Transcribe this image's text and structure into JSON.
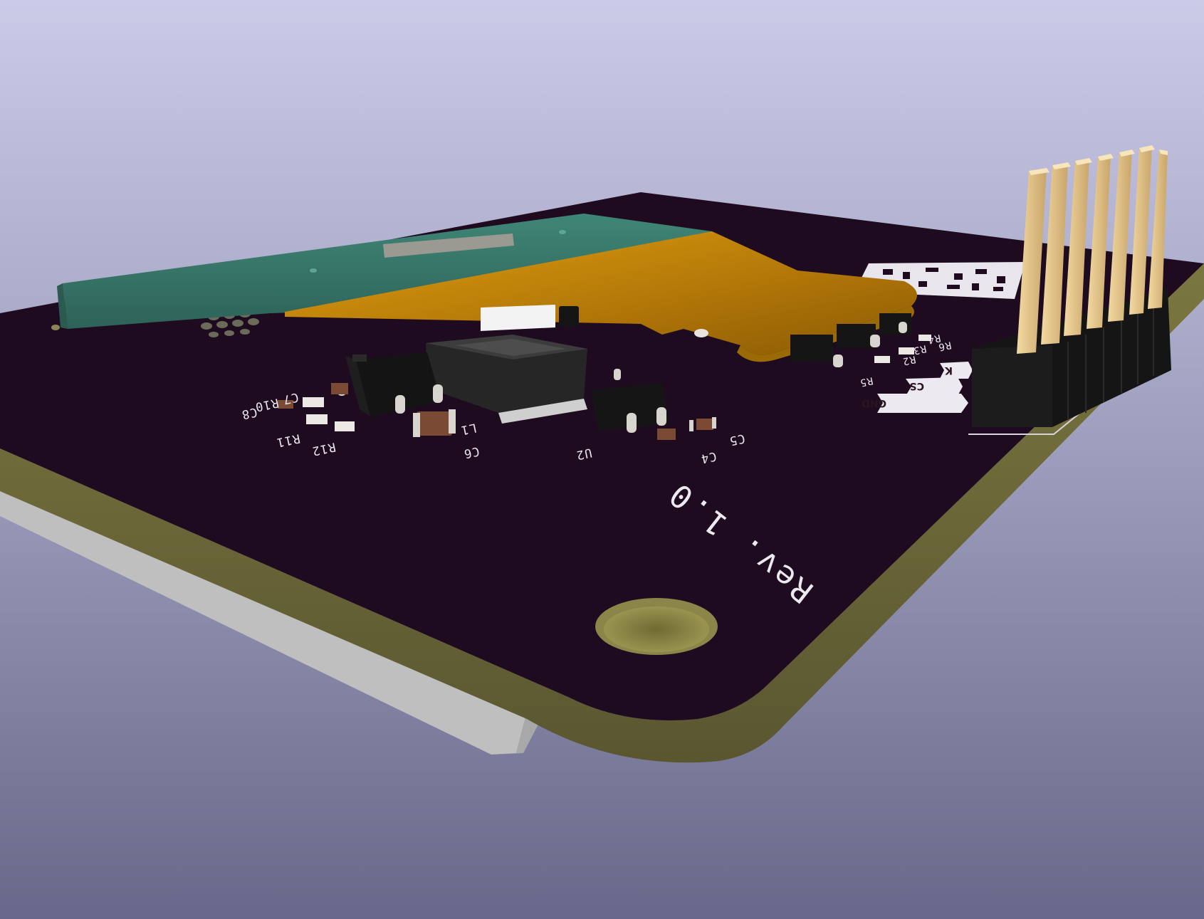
{
  "scene": {
    "colors": {
      "bg_top": "#c8c8e6",
      "bg_bottom": "#6a6a8a",
      "pcb_surface": "#1e0b20",
      "pcb_edge": "#6e6a38",
      "solder_mask_teal": "#3a7a6e",
      "kapton_flex": "#c98a0c",
      "header_pins": "#e8c98a",
      "header_body": "#151515",
      "display_glass": "#bdbdbd"
    }
  },
  "silkscreen": {
    "rev": "Rev. 1.0",
    "refs": [
      "C7",
      "R10",
      "C8",
      "R11",
      "R12",
      "L1",
      "C6",
      "U2",
      "C5",
      "C4",
      "R5",
      "R4",
      "R6",
      "R3",
      "R2"
    ],
    "pin_labels": [
      "GND",
      "CS",
      "K"
    ]
  }
}
